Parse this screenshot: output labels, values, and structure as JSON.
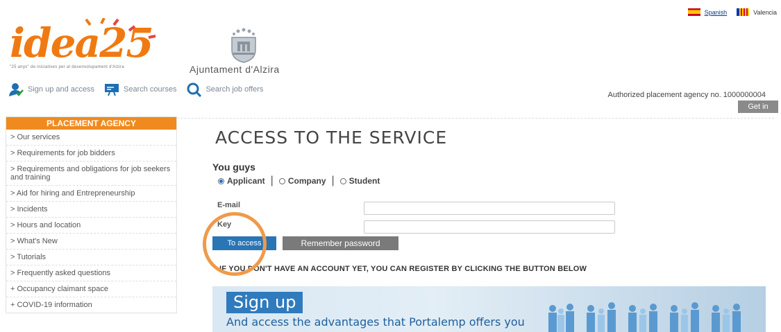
{
  "language": {
    "spanish": "Spanish",
    "valencia": "Valencia"
  },
  "logo": {
    "idea_text": "idea25",
    "idea_tagline": "\"25 anys\" de iniciatives per al desenvolupament d'Alzira",
    "ajuntament": "Ajuntament d'Alzira"
  },
  "agency_number": "Authorized placement agency no. 1000000004",
  "topnav": {
    "sign_up": "Sign up and access",
    "search_courses": "Search courses",
    "search_jobs": "Search job offers",
    "get_in": "Get in"
  },
  "sidebar": {
    "heading": "PLACEMENT AGENCY",
    "items": [
      "> Our services",
      "> Requirements for job bidders",
      "> Requirements and obligations for job seekers and training",
      "> Aid for hiring and Entrepreneurship",
      "> Incidents",
      "> Hours and location",
      "> What's New",
      "> Tutorials",
      "> Frequently asked questions",
      "+ Occupancy claimant space",
      "+ COVID-19 information"
    ]
  },
  "main": {
    "title": "ACCESS TO THE SERVICE",
    "you_guys": "You guys",
    "radios": {
      "applicant": "Applicant",
      "company": "Company",
      "student": "Student",
      "selected": "Applicant"
    },
    "email_label": "E-mail",
    "key_label": "Key",
    "email_value": "",
    "key_value": "",
    "access_button": "To access",
    "remember_button": "Remember password",
    "register_text": "IF YOU DON'T HAVE AN ACCOUNT YET, YOU CAN REGISTER BY CLICKING THE BUTTON BELOW",
    "banner_sign_up": "Sign up",
    "banner_sub": "And access the advantages that Portalemp offers you"
  },
  "colors": {
    "accent_orange": "#f08a1e",
    "primary_blue": "#2a75b4",
    "highlight_circle": "#ef9a4a"
  }
}
